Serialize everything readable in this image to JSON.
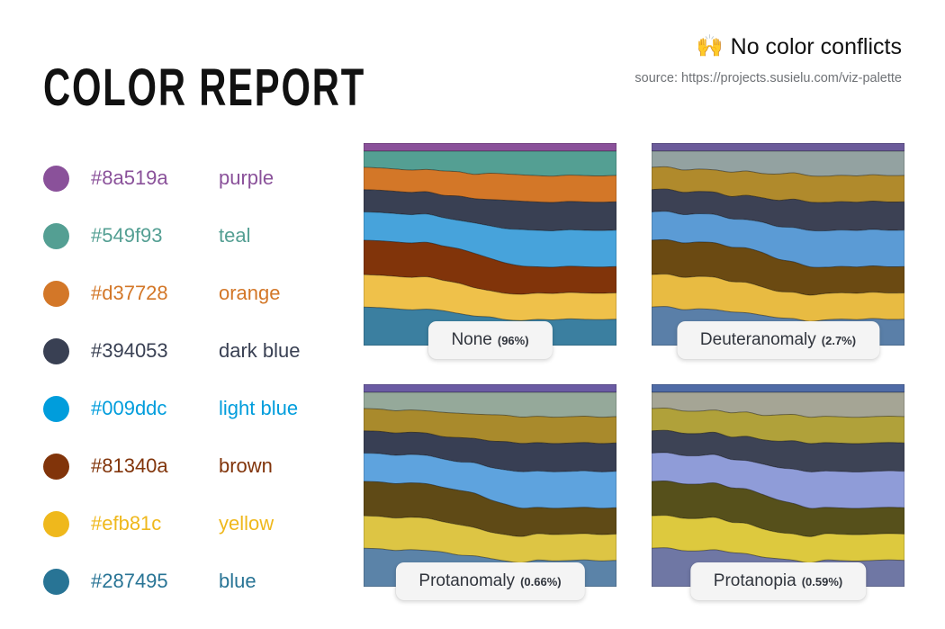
{
  "header": {
    "title": "COLOR REPORT",
    "conflict_status": "No color conflicts",
    "conflict_icon": "raising-hands-emoji",
    "conflict_icon_glyph": "🙌",
    "source": "source: https://projects.susielu.com/viz-palette"
  },
  "legend": {
    "items": [
      {
        "hex": "#8a519a",
        "name": "purple"
      },
      {
        "hex": "#549f93",
        "name": "teal"
      },
      {
        "hex": "#d37728",
        "name": "orange"
      },
      {
        "hex": "#394053",
        "name": "dark blue"
      },
      {
        "hex": "#009ddc",
        "name": "light blue"
      },
      {
        "hex": "#81340a",
        "name": "brown"
      },
      {
        "hex": "#efb81c",
        "name": "yellow"
      },
      {
        "hex": "#287495",
        "name": "blue"
      }
    ]
  },
  "chart_data": {
    "type": "area",
    "title": "COLOR REPORT",
    "subtitle": "No color conflicts",
    "xlabel": "",
    "ylabel": "",
    "grid": false,
    "legend_position": "left",
    "description": "Four stacked streamgraph previews of the same 8-color palette rendered under different color-vision-deficiency simulations.",
    "series_names": [
      "purple",
      "teal",
      "orange",
      "dark blue",
      "light blue",
      "brown",
      "yellow",
      "blue"
    ],
    "x": [
      0,
      1,
      2,
      3,
      4,
      5,
      6,
      7,
      8,
      9,
      10,
      11,
      12,
      13,
      14,
      15,
      16
    ],
    "series": [
      {
        "name": "purple",
        "values": [
          4,
          4,
          4,
          4,
          4,
          4,
          4,
          4,
          4,
          4,
          4,
          4,
          4,
          4,
          4,
          4,
          4
        ]
      },
      {
        "name": "teal",
        "values": [
          8,
          8,
          9,
          9,
          9,
          10,
          10,
          11,
          11,
          11,
          12,
          12,
          12,
          12,
          12,
          12,
          12
        ]
      },
      {
        "name": "orange",
        "values": [
          11,
          11,
          11,
          11,
          11,
          12,
          12,
          12,
          13,
          13,
          13,
          13,
          13,
          13,
          13,
          13,
          13
        ]
      },
      {
        "name": "dark blue",
        "values": [
          11,
          11,
          11,
          11,
          11,
          11,
          12,
          12,
          13,
          14,
          14,
          14,
          14,
          14,
          14,
          14,
          14
        ]
      },
      {
        "name": "light blue",
        "values": [
          14,
          14,
          14,
          14,
          14,
          14,
          14,
          15,
          16,
          17,
          18,
          18,
          18,
          18,
          18,
          18,
          18
        ]
      },
      {
        "name": "brown",
        "values": [
          17,
          17,
          17,
          17,
          17,
          17,
          17,
          17,
          16,
          15,
          14,
          13,
          13,
          13,
          13,
          13,
          13
        ]
      },
      {
        "name": "yellow",
        "values": [
          16,
          16,
          16,
          16,
          16,
          15,
          15,
          14,
          13,
          13,
          13,
          13,
          13,
          13,
          13,
          13,
          13
        ]
      },
      {
        "name": "blue",
        "values": [
          19,
          19,
          18,
          18,
          18,
          17,
          16,
          15,
          14,
          13,
          12,
          13,
          13,
          13,
          13,
          13,
          13
        ]
      }
    ],
    "panels": [
      {
        "name": "None",
        "percent": "(96%)",
        "colors": [
          "#8a519a",
          "#549f93",
          "#d37728",
          "#394053",
          "#47a3db",
          "#81340a",
          "#efc14a",
          "#3b7fa0"
        ]
      },
      {
        "name": "Deuteranomaly",
        "percent": "(2.7%)",
        "colors": [
          "#6b5b9a",
          "#93a2a1",
          "#b08a2c",
          "#3c4154",
          "#5b9bd5",
          "#6b4a12",
          "#e8bb42",
          "#5a7fa8"
        ]
      },
      {
        "name": "Protanomaly",
        "percent": "(0.66%)",
        "colors": [
          "#6a5ba3",
          "#95a99a",
          "#a98a2c",
          "#383f54",
          "#5ea3de",
          "#5f4a16",
          "#ddc544",
          "#5b83a8"
        ]
      },
      {
        "name": "Protanopia",
        "percent": "(0.59%)",
        "colors": [
          "#4f6ba6",
          "#a5a595",
          "#b0a13a",
          "#3d4355",
          "#8f9cd8",
          "#56501b",
          "#ddc93e",
          "#6f77a4"
        ]
      }
    ],
    "wave_profiles": [
      [
        0.0,
        0.1,
        -0.05,
        0.12,
        0.02,
        -0.08,
        0.06,
        0.14,
        -0.03,
        0.09,
        -0.1,
        0.04,
        0.11,
        -0.06,
        0.03,
        0.08,
        0.0
      ],
      [
        0.0,
        -0.08,
        0.11,
        -0.04,
        0.09,
        0.13,
        -0.06,
        0.02,
        0.1,
        -0.09,
        0.05,
        0.12,
        -0.02,
        0.07,
        -0.11,
        0.04,
        0.0
      ],
      [
        0.0,
        0.09,
        0.03,
        -0.1,
        0.06,
        -0.04,
        0.12,
        -0.07,
        0.01,
        0.11,
        0.08,
        -0.05,
        0.09,
        0.02,
        -0.08,
        0.1,
        0.0
      ],
      [
        0.0,
        -0.05,
        0.08,
        0.11,
        -0.07,
        0.03,
        -0.09,
        0.13,
        0.05,
        -0.02,
        0.1,
        -0.06,
        0.04,
        0.12,
        0.01,
        -0.07,
        0.0
      ]
    ]
  }
}
